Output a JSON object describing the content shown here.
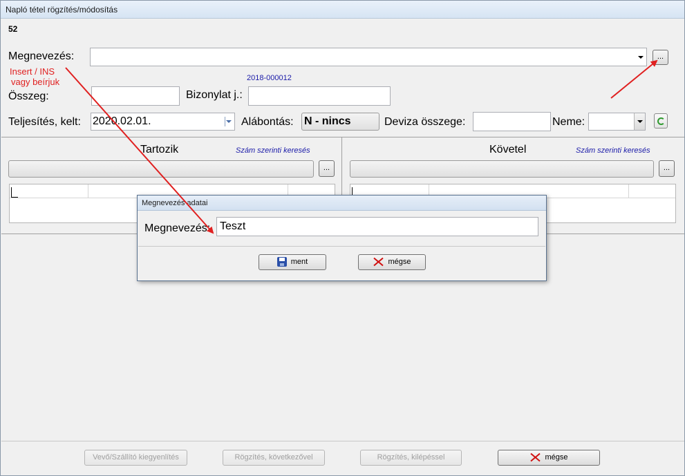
{
  "window": {
    "title": "Napló tétel rögzítés/módosítás",
    "record_number": "52"
  },
  "form": {
    "megnevezes_label": "Megnevezés:",
    "megnevezes_value": "",
    "browse_button": "...",
    "note_line1": "Insert / INS",
    "note_line2": "vagy beírjuk",
    "bizonylat_hint": "2018-000012",
    "osszeg_label": "Összeg:",
    "osszeg_value": "",
    "bizonylat_label": "Bizonylat j.:",
    "bizonylat_value": "",
    "teljesites_label": "Teljesítés, kelt:",
    "teljesites_value": "2020.02.01.",
    "alabontas_label": "Alábontás:",
    "alabontas_value": "N - nincs",
    "deviza_label": "Deviza összege:",
    "deviza_value": "",
    "neme_label": "Neme:",
    "neme_value": ""
  },
  "tartozik": {
    "title": "Tartozik",
    "search_link": "Szám szerinti keresés",
    "browse_button": "..."
  },
  "kovetel": {
    "title": "Követel",
    "search_link": "Szám szerinti keresés",
    "browse_button": "..."
  },
  "dialog": {
    "title": "Megnevezés adatai",
    "label": "Megnevezés:",
    "value": "Teszt",
    "save_label": "ment",
    "cancel_label": "mégse"
  },
  "footer": {
    "vevo_label": "Vevő/Szállító kiegyenlítés",
    "rogzites_kov_label": "Rögzítés, következővel",
    "rogzites_kilep_label": "Rögzítés, kilépéssel",
    "megse_label": "mégse"
  },
  "colors": {
    "annotation": "#e02020",
    "link": "#1a1aa8",
    "save_icon": "#2a4fa8",
    "cancel_icon": "#d01010"
  }
}
